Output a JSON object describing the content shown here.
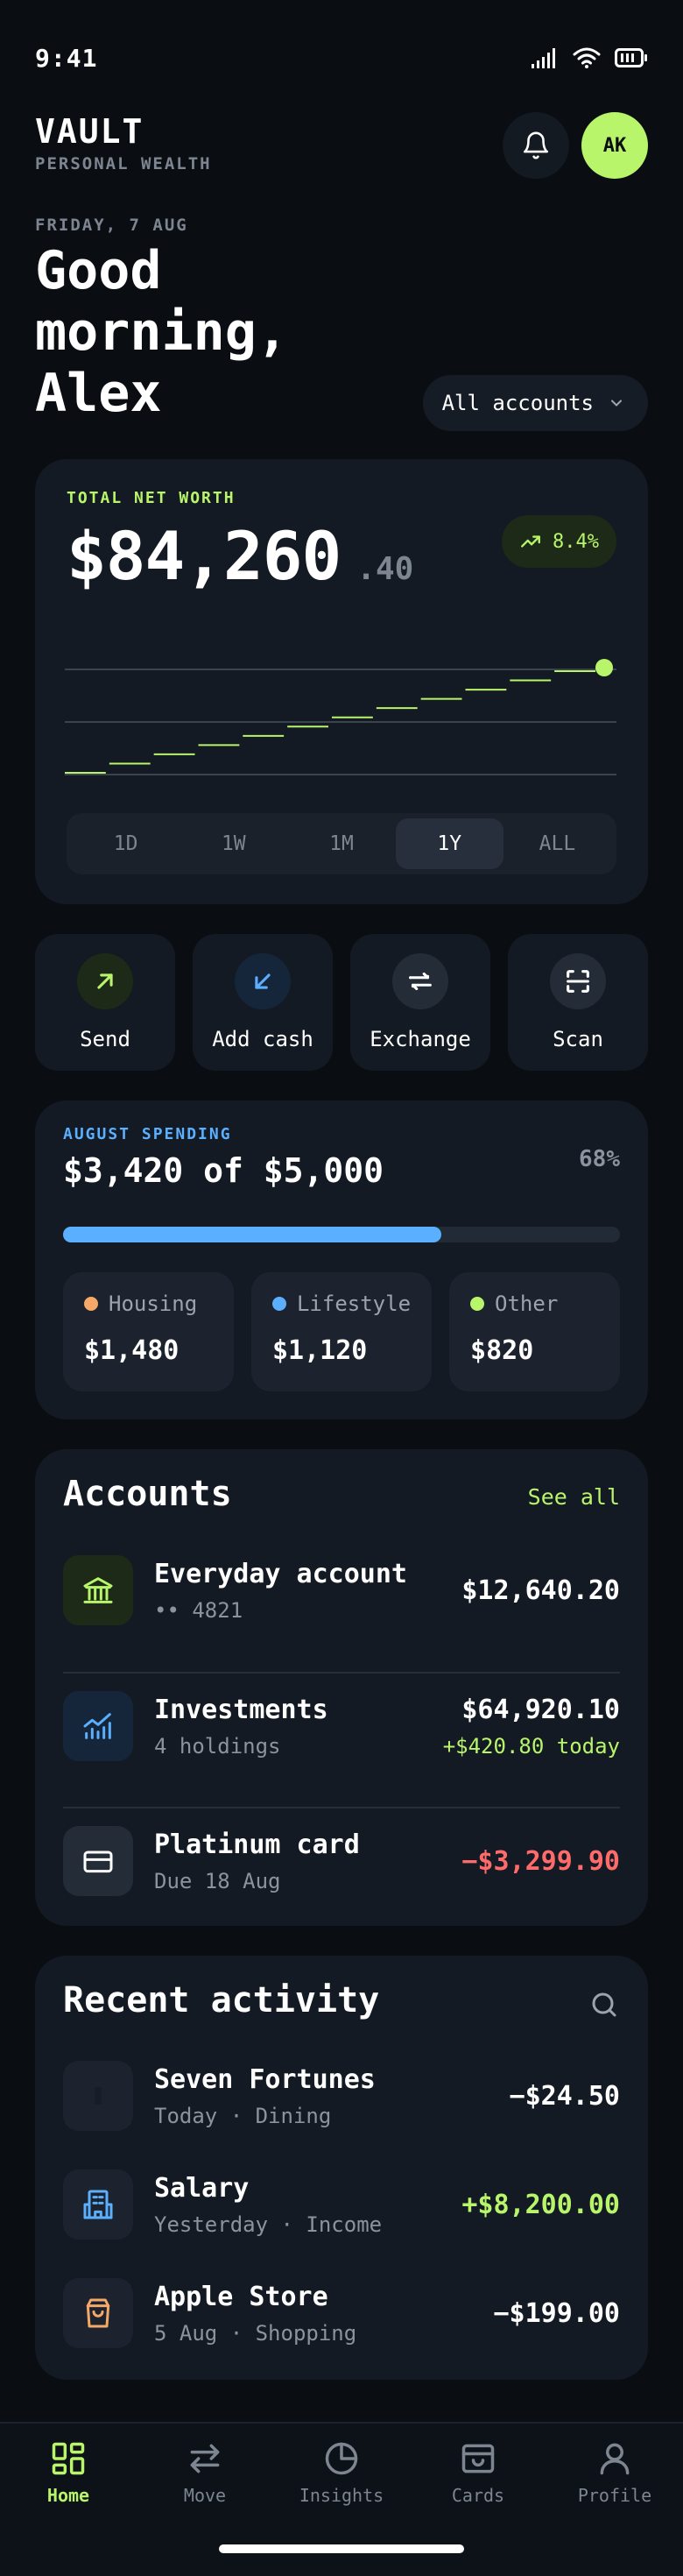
{
  "status_bar": {
    "time": "9:41"
  },
  "header": {
    "brand": "VAULT",
    "brand_sub": "PERSONAL WEALTH",
    "avatar_initials": "AK",
    "date": "FRIDAY, 7 AUG",
    "greeting": "Good morning, Alex",
    "account_selector": "All accounts"
  },
  "net_worth": {
    "label": "TOTAL NET WORTH",
    "value_main": "$84,260",
    "value_cents": ".40",
    "change": "8.4%",
    "chart_steps": 12,
    "ranges": [
      {
        "label": "1D",
        "active": false
      },
      {
        "label": "1W",
        "active": false
      },
      {
        "label": "1M",
        "active": false
      },
      {
        "label": "1Y",
        "active": true
      },
      {
        "label": "ALL",
        "active": false
      }
    ]
  },
  "quick_actions": [
    {
      "label": "Send",
      "icon": "arrow-up-right-icon",
      "color": "#b8f56a",
      "bg": "#1d2a17"
    },
    {
      "label": "Add cash",
      "icon": "arrow-down-left-icon",
      "color": "#5ab0ff",
      "bg": "#16263a"
    },
    {
      "label": "Exchange",
      "icon": "exchange-icon",
      "color": "#ffffff",
      "bg": "#242c37"
    },
    {
      "label": "Scan",
      "icon": "scan-icon",
      "color": "#ffffff",
      "bg": "#242c37"
    }
  ],
  "spending": {
    "label": "AUGUST SPENDING",
    "summary": "$3,420 of $5,000",
    "percent": "68%",
    "progress": 0.68,
    "categories": [
      {
        "name": "Housing",
        "amount": "$1,480",
        "color": "#f5a868"
      },
      {
        "name": "Lifestyle",
        "amount": "$1,120",
        "color": "#5ab0ff"
      },
      {
        "name": "Other",
        "amount": "$820",
        "color": "#b8f56a"
      }
    ]
  },
  "accounts": {
    "title": "Accounts",
    "see_all": "See all",
    "items": [
      {
        "name": "Everyday account",
        "sub": "•• 4821",
        "amount": "$12,640.20",
        "icon": "bank-icon"
      },
      {
        "name": "Investments",
        "sub": "4 holdings",
        "amount": "$64,920.10",
        "gain": "+$420.80 today",
        "icon": "chart-icon"
      },
      {
        "name": "Platinum card",
        "sub": "Due 18 Aug",
        "amount": "−$3,299.90",
        "icon": "card-icon"
      }
    ]
  },
  "activity": {
    "title": "Recent activity",
    "items": [
      {
        "name": "Seven Fortunes",
        "sub": "Today · Dining",
        "amount": "−$24.50",
        "icon": "dining-icon"
      },
      {
        "name": "Salary",
        "sub": "Yesterday · Income",
        "amount": "+$8,200.00",
        "icon": "building-icon"
      },
      {
        "name": "Apple Store",
        "sub": "5 Aug · Shopping",
        "amount": "−$199.00",
        "icon": "shopping-bag-icon"
      }
    ]
  },
  "tab_bar": [
    {
      "label": "Home",
      "icon": "home-grid-icon",
      "active": true
    },
    {
      "label": "Move",
      "icon": "move-arrows-icon",
      "active": false
    },
    {
      "label": "Insights",
      "icon": "pie-chart-icon",
      "active": false
    },
    {
      "label": "Cards",
      "icon": "cards-icon",
      "active": false
    },
    {
      "label": "Profile",
      "icon": "profile-icon",
      "active": false
    }
  ]
}
